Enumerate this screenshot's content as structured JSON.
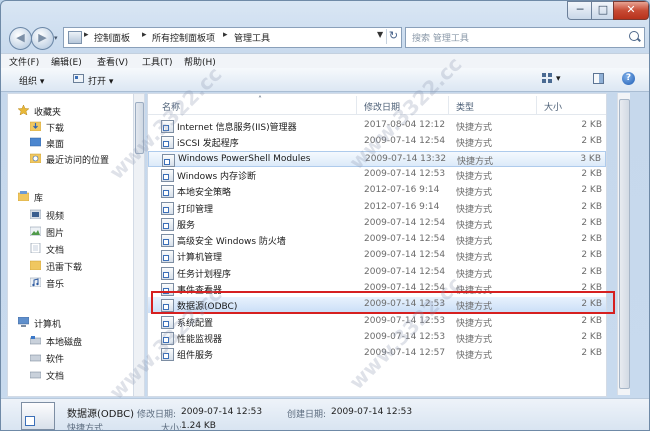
{
  "window": {
    "min_label": "─",
    "max_label": "□",
    "close_label": "✕"
  },
  "nav": {
    "back_icon": "back-arrow-icon",
    "forward_icon": "forward-arrow-icon"
  },
  "address": {
    "crumbs": [
      "控制面板",
      "所有控制面板项",
      "管理工具"
    ],
    "separator": "▸"
  },
  "search": {
    "placeholder": "搜索 管理工具"
  },
  "menubar": [
    "文件(F)",
    "编辑(E)",
    "查看(V)",
    "工具(T)",
    "帮助(H)"
  ],
  "toolbar": {
    "organize": "组织 ▾",
    "open": "打开 ▾",
    "help": "?"
  },
  "sidebar": {
    "favorites": {
      "label": "收藏夹",
      "items": [
        "下载",
        "桌面",
        "最近访问的位置"
      ]
    },
    "libraries": {
      "label": "库",
      "items": [
        "视频",
        "图片",
        "文档",
        "迅雷下载",
        "音乐"
      ]
    },
    "computer": {
      "label": "计算机",
      "items": [
        "本地磁盘",
        "软件",
        "文档"
      ]
    }
  },
  "columns": {
    "name": "名称",
    "date": "修改日期",
    "type": "类型",
    "size": "大小"
  },
  "files": [
    {
      "name": "Internet 信息服务(IIS)管理器",
      "date": "2017-08-04 12:12",
      "type": "快捷方式",
      "size": "2 KB"
    },
    {
      "name": "iSCSI 发起程序",
      "date": "2009-07-14 12:54",
      "type": "快捷方式",
      "size": "2 KB"
    },
    {
      "name": "Windows PowerShell Modules",
      "date": "2009-07-14 13:32",
      "type": "快捷方式",
      "size": "3 KB"
    },
    {
      "name": "Windows 内存诊断",
      "date": "2009-07-14 12:53",
      "type": "快捷方式",
      "size": "2 KB"
    },
    {
      "name": "本地安全策略",
      "date": "2012-07-16 9:14",
      "type": "快捷方式",
      "size": "2 KB"
    },
    {
      "name": "打印管理",
      "date": "2012-07-16 9:14",
      "type": "快捷方式",
      "size": "2 KB"
    },
    {
      "name": "服务",
      "date": "2009-07-14 12:54",
      "type": "快捷方式",
      "size": "2 KB"
    },
    {
      "name": "高级安全 Windows 防火墙",
      "date": "2009-07-14 12:54",
      "type": "快捷方式",
      "size": "2 KB"
    },
    {
      "name": "计算机管理",
      "date": "2009-07-14 12:54",
      "type": "快捷方式",
      "size": "2 KB"
    },
    {
      "name": "任务计划程序",
      "date": "2009-07-14 12:54",
      "type": "快捷方式",
      "size": "2 KB"
    },
    {
      "name": "事件查看器",
      "date": "2009-07-14 12:54",
      "type": "快捷方式",
      "size": "2 KB"
    },
    {
      "name": "数据源(ODBC)",
      "date": "2009-07-14 12:53",
      "type": "快捷方式",
      "size": "2 KB"
    },
    {
      "name": "系统配置",
      "date": "2009-07-14 12:53",
      "type": "快捷方式",
      "size": "2 KB"
    },
    {
      "name": "性能监视器",
      "date": "2009-07-14 12:53",
      "type": "快捷方式",
      "size": "2 KB"
    },
    {
      "name": "组件服务",
      "date": "2009-07-14 12:57",
      "type": "快捷方式",
      "size": "2 KB"
    }
  ],
  "selected_index": 11,
  "highlighted_index": 2,
  "status": {
    "name": "数据源(ODBC)",
    "modified_label": "修改日期:",
    "modified": "2009-07-14 12:53",
    "created_label": "创建日期:",
    "created": "2009-07-14 12:53",
    "type": "快捷方式",
    "size_label": "大小:",
    "size": "1.24 KB"
  },
  "watermark": "www.3322.cc",
  "colors": {
    "selection_border": "#d62020",
    "accent": "#3b6fb8"
  }
}
